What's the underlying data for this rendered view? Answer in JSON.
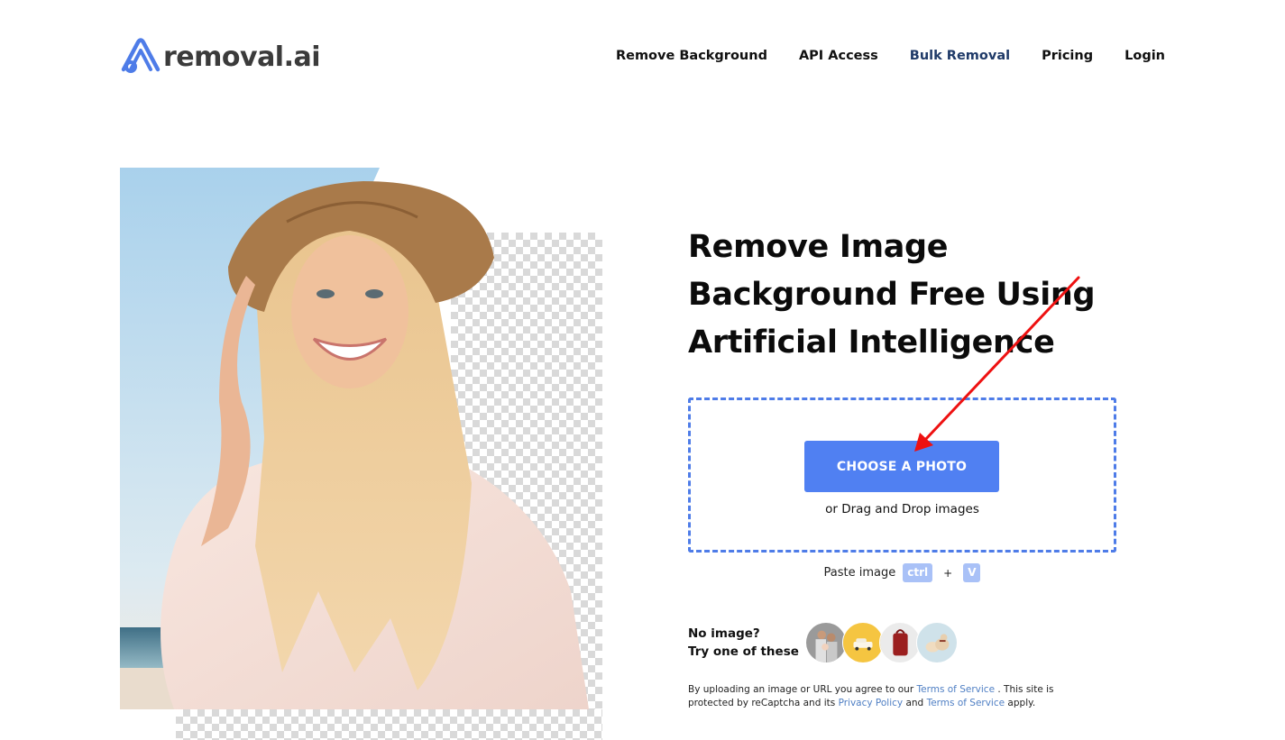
{
  "brand": {
    "name": "removal.ai",
    "logo_icon": "removal-ai-logo-icon",
    "accent_color": "#4e7ce8"
  },
  "nav": {
    "items": [
      {
        "label": "Remove Background",
        "active": false
      },
      {
        "label": "API Access",
        "active": false
      },
      {
        "label": "Bulk Removal",
        "active": true
      },
      {
        "label": "Pricing",
        "active": false
      },
      {
        "label": "Login",
        "active": false
      }
    ]
  },
  "hero": {
    "image_alt": "Smiling woman in straw hat on beach with background partially removed (transparent checkerboard)",
    "headline_lines": [
      "Remove Image",
      "Background Free Using",
      "Artificial Intelligence"
    ]
  },
  "upload": {
    "button_label": "CHOOSE A PHOTO",
    "button_color": "#5080f2",
    "drag_text": "or Drag and Drop images",
    "paste_label": "Paste image",
    "paste_key1": "ctrl",
    "paste_plus": "+",
    "paste_key2": "V"
  },
  "samples": {
    "label_line1": "No image?",
    "label_line2": "Try one of these",
    "thumbnails": [
      {
        "name": "family-sample",
        "alt": "Family photo"
      },
      {
        "name": "car-sample",
        "alt": "White car on yellow"
      },
      {
        "name": "backpack-sample",
        "alt": "Red backpack"
      },
      {
        "name": "dog-sample",
        "alt": "Puppies"
      }
    ]
  },
  "legal": {
    "text1": "By uploading an image or URL you agree to our ",
    "link_terms1": "Terms of Service",
    "text2": " . This site is protected by reCaptcha and its ",
    "link_privacy": "Privacy Policy",
    "text3": " and ",
    "link_terms2": "Terms of Service",
    "text4": " apply."
  },
  "annotation": {
    "type": "red-arrow",
    "points_to": "choose-photo-button",
    "color": "#ee1111"
  }
}
